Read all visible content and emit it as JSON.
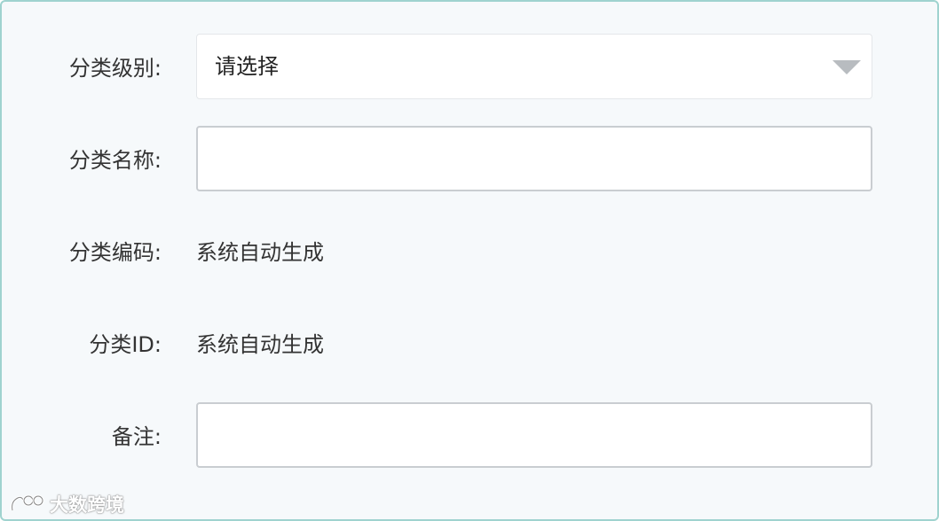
{
  "form": {
    "category_level": {
      "label": "分类级别:",
      "selected": "请选择"
    },
    "category_name": {
      "label": "分类名称:",
      "value": ""
    },
    "category_code": {
      "label": "分类编码:",
      "value": "系统自动生成"
    },
    "category_id": {
      "label": "分类ID:",
      "value": "系统自动生成"
    },
    "remark": {
      "label": "备注:",
      "value": ""
    }
  },
  "watermark": {
    "text": "大数跨境",
    "icon": "logo-icon"
  },
  "colors": {
    "panel_border": "#9fd3cf",
    "panel_background": "#f6f9fb",
    "input_border": "#c9cdd1",
    "caret": "#b8bcc0"
  }
}
